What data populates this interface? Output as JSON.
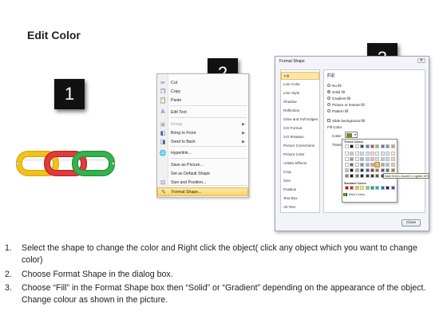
{
  "page": {
    "title": "Edit Color"
  },
  "panels": {
    "step1_number": "1",
    "step2_number": "2",
    "step3_number": "3"
  },
  "chain": {
    "colors": [
      "#f2c21a",
      "#e23b3b",
      "#35b34a"
    ]
  },
  "context_menu": {
    "items": [
      {
        "icon": "scissors-icon",
        "label": "Cut",
        "enabled": true,
        "submenu": false
      },
      {
        "icon": "copy-icon",
        "label": "Copy",
        "enabled": true,
        "submenu": false
      },
      {
        "icon": "paste-icon",
        "label": "Paste",
        "enabled": true,
        "submenu": false
      },
      {
        "icon": "edit-text-icon",
        "label": "Edit Text",
        "enabled": true,
        "submenu": false
      },
      {
        "icon": "group-icon",
        "label": "Group",
        "enabled": false,
        "submenu": true
      },
      {
        "icon": "bring-to-front-icon",
        "label": "Bring to Front",
        "enabled": true,
        "submenu": true
      },
      {
        "icon": "send-to-back-icon",
        "label": "Send to Back",
        "enabled": true,
        "submenu": true
      },
      {
        "icon": "hyperlink-icon",
        "label": "Hyperlink...",
        "enabled": true,
        "submenu": false
      },
      {
        "icon": "",
        "label": "Save as Picture...",
        "enabled": true,
        "submenu": false
      },
      {
        "icon": "",
        "label": "Set as Default Shape",
        "enabled": true,
        "submenu": false
      },
      {
        "icon": "size-position-icon",
        "label": "Size and Position...",
        "enabled": true,
        "submenu": false
      },
      {
        "icon": "format-shape-icon",
        "label": "Format Shape...",
        "enabled": true,
        "submenu": false,
        "highlighted": true
      }
    ]
  },
  "dialog": {
    "title": "Format Shape",
    "close_label": "Close",
    "categories": [
      "Fill",
      "Line Color",
      "Line Style",
      "Shadow",
      "Reflection",
      "Glow and Soft Edges",
      "3-D Format",
      "3-D Rotation",
      "Picture Corrections",
      "Picture Color",
      "Artistic Effects",
      "Crop",
      "Size",
      "Position",
      "Text Box",
      "Alt Text"
    ],
    "selected_category": "Fill",
    "heading": "Fill",
    "fill_options": [
      "No fill",
      "Solid fill",
      "Gradient fill",
      "Picture or texture fill",
      "Pattern fill"
    ],
    "selected_fill": "Solid fill",
    "slide_background_label": "Slide background fill",
    "fill_color_label": "Fill Color",
    "color_label": "Color:",
    "transparency_label": "Transpa"
  },
  "color_popup": {
    "theme_header": "Theme Colors",
    "standard_header": "Standard Colors",
    "more_label": "More Colors...",
    "theme_top": [
      "#ffffff",
      "#000000",
      "#eeece1",
      "#1f497d",
      "#4f81bd",
      "#c0504d",
      "#9bbb59",
      "#8064a2",
      "#4bacc6",
      "#f79646"
    ],
    "standard": [
      "#c00000",
      "#ff0000",
      "#ffc000",
      "#ffff00",
      "#92d050",
      "#00b050",
      "#00b0f0",
      "#0070c0",
      "#002060",
      "#7030a0"
    ],
    "tooltip": "Dark Green, Accent 2, Lighter 40%"
  },
  "instructions": [
    {
      "number": "1.",
      "text": "Select the shape to change the color and Right click the object( click any object which you want to change color)"
    },
    {
      "number": "2.",
      "text": "Choose Format Shape in the dialog box."
    },
    {
      "number": "3.",
      "text": "Choose “Fill” in the Format Shape box then “Solid” or “Gradient” depending on the appearance of the object. Change colour as shown in the picture."
    }
  ]
}
